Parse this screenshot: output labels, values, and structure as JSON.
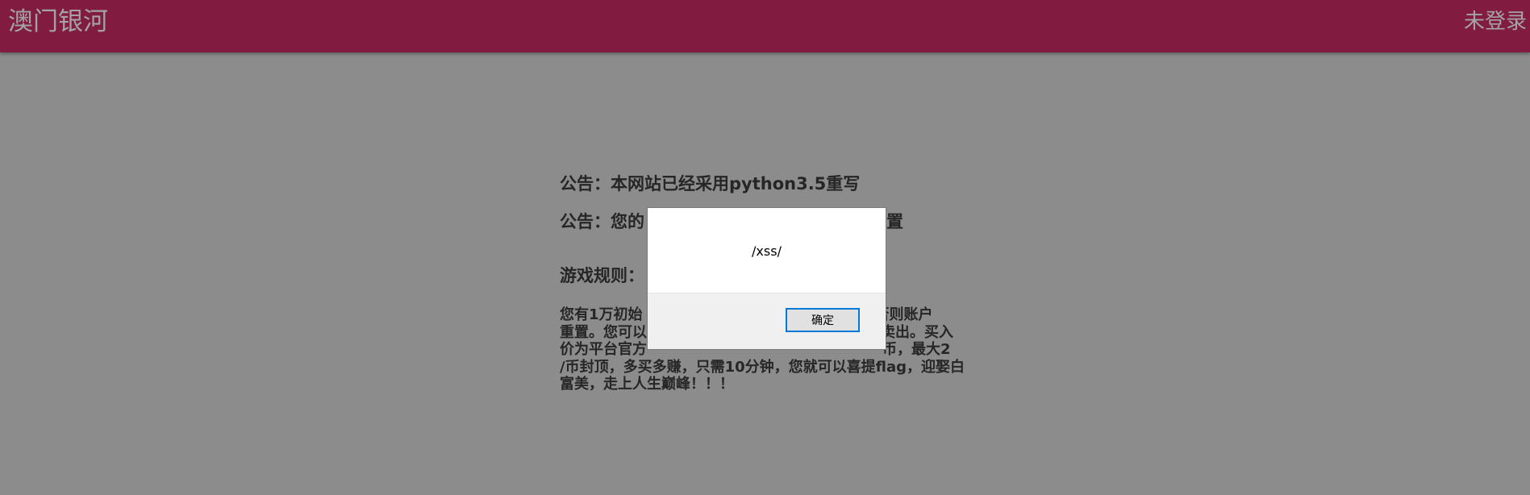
{
  "header": {
    "brand": "澳门银河",
    "login_status": "未登录"
  },
  "content": {
    "notice_1": "公告：本网站已经采用python3.5重写",
    "notice_2_visible_start": "公告：您的",
    "notice_2_visible_end": "置",
    "rules_title": "游戏规则：",
    "rules_text_lines": [
      "您有1万初始",
      "重置。您可以",
      "价为平台官方",
      "/币封顶，多买多赚，只需10分钟，您就可以喜提flag，迎娶白",
      "富美，走上人生巅峰！！！"
    ],
    "rules_text_right_fragments": [
      "，否则账户",
      "时卖出。买入",
      "币，最大2"
    ]
  },
  "dialog": {
    "message": "/xss/",
    "ok_label": "确定"
  },
  "colors": {
    "navbar": "#811b3f",
    "overlay_background": "#8c8c8c",
    "dialog_button_border": "#0078d7"
  }
}
